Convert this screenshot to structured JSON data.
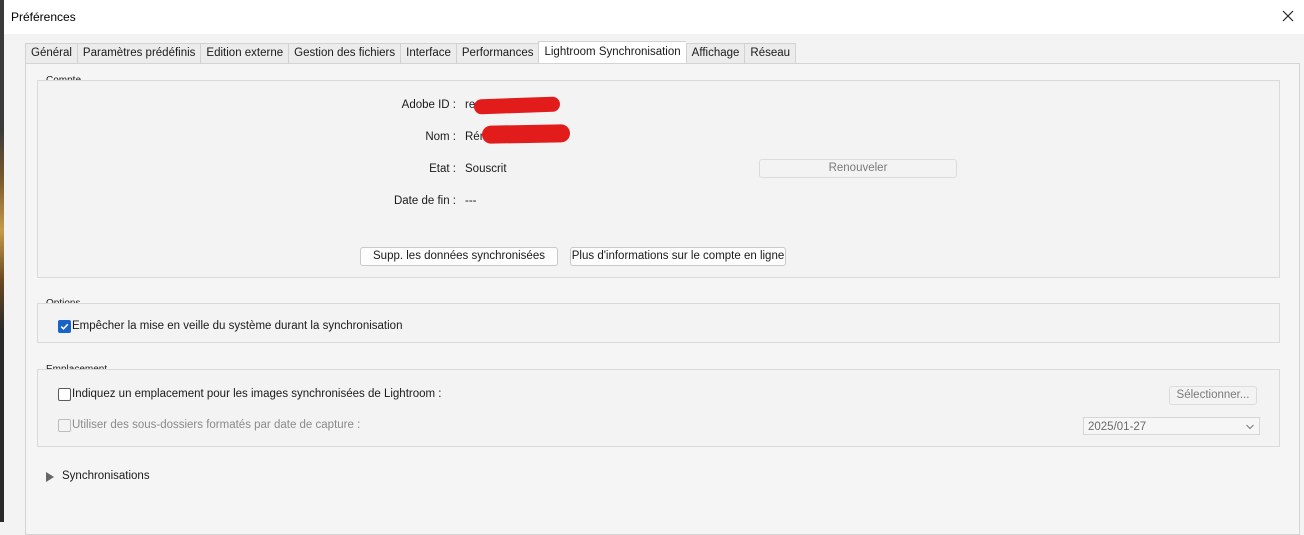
{
  "window": {
    "title": "Préférences"
  },
  "tabs": [
    {
      "label": "Général"
    },
    {
      "label": "Paramètres prédéfinis"
    },
    {
      "label": "Edition externe"
    },
    {
      "label": "Gestion des fichiers"
    },
    {
      "label": "Interface"
    },
    {
      "label": "Performances"
    },
    {
      "label": "Lightroom Synchronisation",
      "active": true
    },
    {
      "label": "Affichage"
    },
    {
      "label": "Réseau"
    }
  ],
  "account": {
    "legend": "Compte",
    "adobe_id_label": "Adobe ID :",
    "adobe_id_value": "re",
    "name_label": "Nom :",
    "name_value": "Rém",
    "state_label": "Etat :",
    "state_value": "Souscrit",
    "end_date_label": "Date de fin :",
    "end_date_value": "---",
    "renew_button": "Renouveler",
    "delete_sync_button": "Supp. les données synchronisées",
    "more_info_button": "Plus d'informations sur le compte en ligne"
  },
  "options": {
    "legend": "Options",
    "prevent_sleep_label": "Empêcher la mise en veille du système durant la synchronisation",
    "prevent_sleep_checked": true
  },
  "location": {
    "legend": "Emplacement",
    "specify_label": "Indiquez un emplacement pour les images synchronisées de Lightroom :",
    "specify_checked": false,
    "select_button": "Sélectionner...",
    "subfolders_label": "Utiliser des sous-dossiers formatés par date de capture :",
    "subfolders_checked": false,
    "date_format_value": "2025/01-27"
  },
  "syncs": {
    "label": "Synchronisations"
  },
  "colors": {
    "accent": "#1a63c6",
    "redaction": "#e21b1b"
  },
  "icons": {
    "close": "close-icon",
    "checkmark": "checkmark-icon",
    "expand": "triangle-right-icon",
    "dropdown": "chevron-down-icon"
  }
}
